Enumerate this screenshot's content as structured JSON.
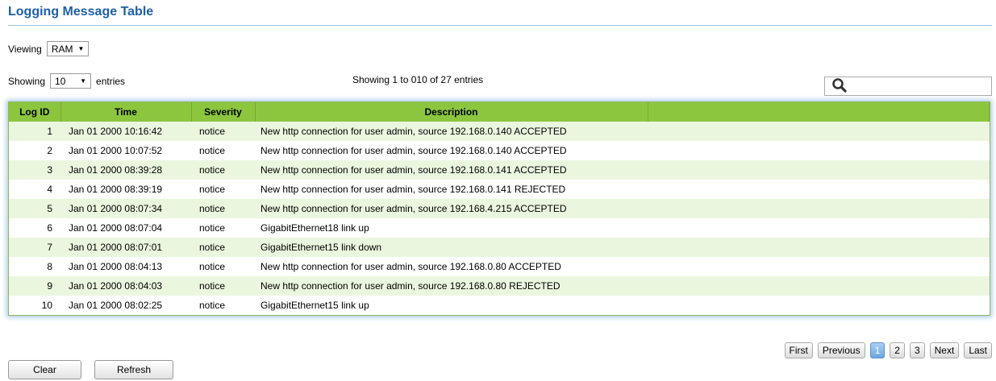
{
  "page": {
    "title": "Logging Message Table"
  },
  "viewing": {
    "label": "Viewing",
    "value": "RAM"
  },
  "entries": {
    "prefix": "Showing",
    "value": "10",
    "suffix": "entries"
  },
  "info": "Showing 1 to 010 of 27 entries",
  "search": {
    "placeholder": ""
  },
  "table": {
    "columns": [
      "Log ID",
      "Time",
      "Severity",
      "Description"
    ],
    "rows": [
      {
        "id": "1",
        "time": "Jan 01 2000 10:16:42",
        "severity": "notice",
        "description": "New http connection for user admin, source 192.168.0.140 ACCEPTED"
      },
      {
        "id": "2",
        "time": "Jan 01 2000 10:07:52",
        "severity": "notice",
        "description": "New http connection for user admin, source 192.168.0.140 ACCEPTED"
      },
      {
        "id": "3",
        "time": "Jan 01 2000 08:39:28",
        "severity": "notice",
        "description": "New http connection for user admin, source 192.168.0.141 ACCEPTED"
      },
      {
        "id": "4",
        "time": "Jan 01 2000 08:39:19",
        "severity": "notice",
        "description": "New http connection for user admin, source 192.168.0.141 REJECTED"
      },
      {
        "id": "5",
        "time": "Jan 01 2000 08:07:34",
        "severity": "notice",
        "description": "New http connection for user admin, source 192.168.4.215 ACCEPTED"
      },
      {
        "id": "6",
        "time": "Jan 01 2000 08:07:04",
        "severity": "notice",
        "description": "GigabitEthernet18 link up"
      },
      {
        "id": "7",
        "time": "Jan 01 2000 08:07:01",
        "severity": "notice",
        "description": "GigabitEthernet15 link down"
      },
      {
        "id": "8",
        "time": "Jan 01 2000 08:04:13",
        "severity": "notice",
        "description": "New http connection for user admin, source 192.168.0.80 ACCEPTED"
      },
      {
        "id": "9",
        "time": "Jan 01 2000 08:04:03",
        "severity": "notice",
        "description": "New http connection for user admin, source 192.168.0.80 REJECTED"
      },
      {
        "id": "10",
        "time": "Jan 01 2000 08:02:25",
        "severity": "notice",
        "description": "GigabitEthernet15 link up"
      }
    ]
  },
  "pagination": {
    "first": "First",
    "previous": "Previous",
    "pages": [
      "1",
      "2",
      "3"
    ],
    "active_page": "1",
    "next": "Next",
    "last": "Last"
  },
  "buttons": {
    "clear": "Clear",
    "refresh": "Refresh"
  },
  "colors": {
    "title": "#1f5fa8",
    "header_bg": "#8cc63f",
    "row_alt": "#ebf6df",
    "active_page": "#6ea6dc"
  },
  "icons": {
    "search": "search-icon",
    "dropdown": "chevron-down-icon"
  }
}
